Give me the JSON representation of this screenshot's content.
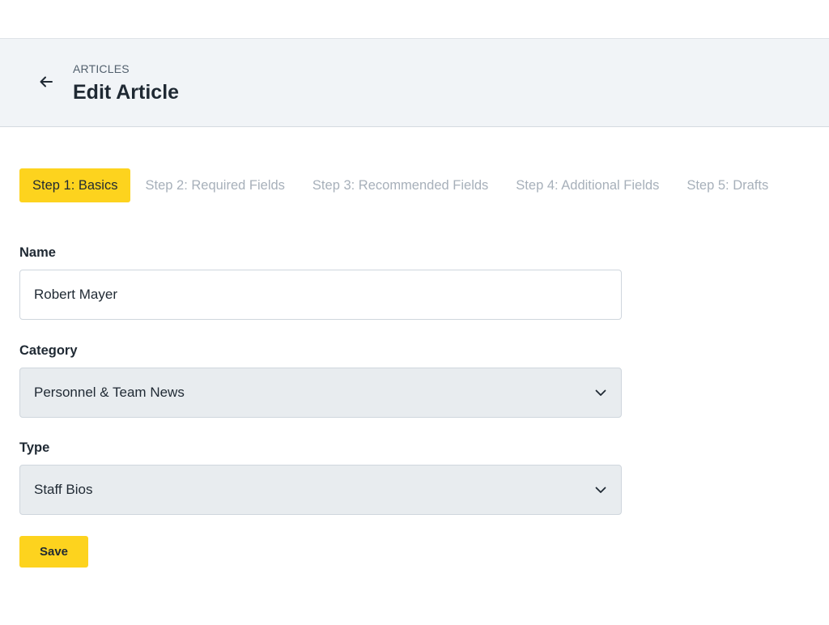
{
  "header": {
    "breadcrumb": "ARTICLES",
    "title": "Edit Article",
    "back_icon": "arrow-left-icon"
  },
  "steps": [
    {
      "label": "Step 1: Basics",
      "active": true
    },
    {
      "label": "Step 2: Required Fields",
      "active": false
    },
    {
      "label": "Step 3: Recommended Fields",
      "active": false
    },
    {
      "label": "Step 4: Additional Fields",
      "active": false
    },
    {
      "label": "Step 5: Drafts",
      "active": false
    }
  ],
  "form": {
    "name": {
      "label": "Name",
      "value": "Robert Mayer"
    },
    "category": {
      "label": "Category",
      "value": "Personnel & Team News",
      "icon": "chevron-down-icon"
    },
    "type": {
      "label": "Type",
      "value": "Staff Bios",
      "icon": "chevron-down-icon"
    },
    "save_label": "Save"
  },
  "colors": {
    "accent": "#fdd31e",
    "header_bg": "#f1f4f7",
    "select_bg": "#e8ecef",
    "inactive_step": "#a7b0ba"
  }
}
